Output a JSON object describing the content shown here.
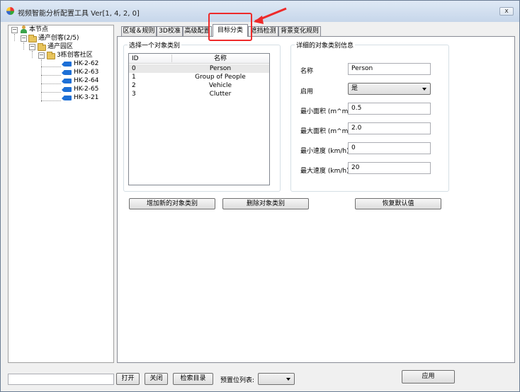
{
  "window": {
    "title": "视频智能分析配置工具 Ver[1, 4, 2, 0]",
    "close_symbol": "x"
  },
  "tree": {
    "nodes": [
      {
        "label": "本节点",
        "icon": "person-icon",
        "expander": "−"
      },
      {
        "label": "通产创客(2/5)",
        "icon": "folder-icon",
        "expander": "−"
      },
      {
        "label": "通产园区",
        "icon": "folder-icon",
        "expander": "−"
      },
      {
        "label": "3栋创客社区",
        "icon": "folder-icon",
        "expander": "−"
      },
      {
        "label": "HK-2-62",
        "icon": "camera-icon"
      },
      {
        "label": "HK-2-63",
        "icon": "camera-icon"
      },
      {
        "label": "HK-2-64",
        "icon": "camera-icon"
      },
      {
        "label": "HK-2-65",
        "icon": "camera-icon"
      },
      {
        "label": "HK-3-21",
        "icon": "camera-icon"
      }
    ]
  },
  "tabs": [
    {
      "label": "区域＆规则"
    },
    {
      "label": "3D校准"
    },
    {
      "label": "高级配置"
    },
    {
      "label": "目标分类",
      "active": true
    },
    {
      "label": "遮挡检测"
    },
    {
      "label": "背景变化规则"
    }
  ],
  "class_list": {
    "group_label": "选择一个对象类别",
    "columns": [
      "ID",
      "名称"
    ],
    "rows": [
      {
        "id": "0",
        "name": "Person"
      },
      {
        "id": "1",
        "name": "Group of People"
      },
      {
        "id": "2",
        "name": "Vehicle"
      },
      {
        "id": "3",
        "name": "Clutter"
      }
    ]
  },
  "details": {
    "group_label": "详细的对象类别信息",
    "name_label": "名称",
    "name_value": "Person",
    "enable_label": "启用",
    "enable_value": "是",
    "min_area_label": "最小面积 (m^m)",
    "min_area_value": "0.5",
    "max_area_label": "最大面积 (m^m)",
    "max_area_value": "2.0",
    "min_speed_label": "最小速度 (km/h)",
    "min_speed_value": "0",
    "max_speed_label": "最大速度 (km/h)",
    "max_speed_value": "20"
  },
  "buttons": {
    "add": "增加新的对象类别",
    "delete": "删除对象类别",
    "restore": "恢复默认值",
    "open": "打开",
    "close": "关闭",
    "browse": "检索目录",
    "apply": "应用"
  },
  "bottom": {
    "preset_label": "预置位列表:",
    "preset_value": ""
  },
  "colors": {
    "highlight": "#ee2a2a",
    "camera": "#1d6fd6",
    "folder": "#e8c45c"
  }
}
